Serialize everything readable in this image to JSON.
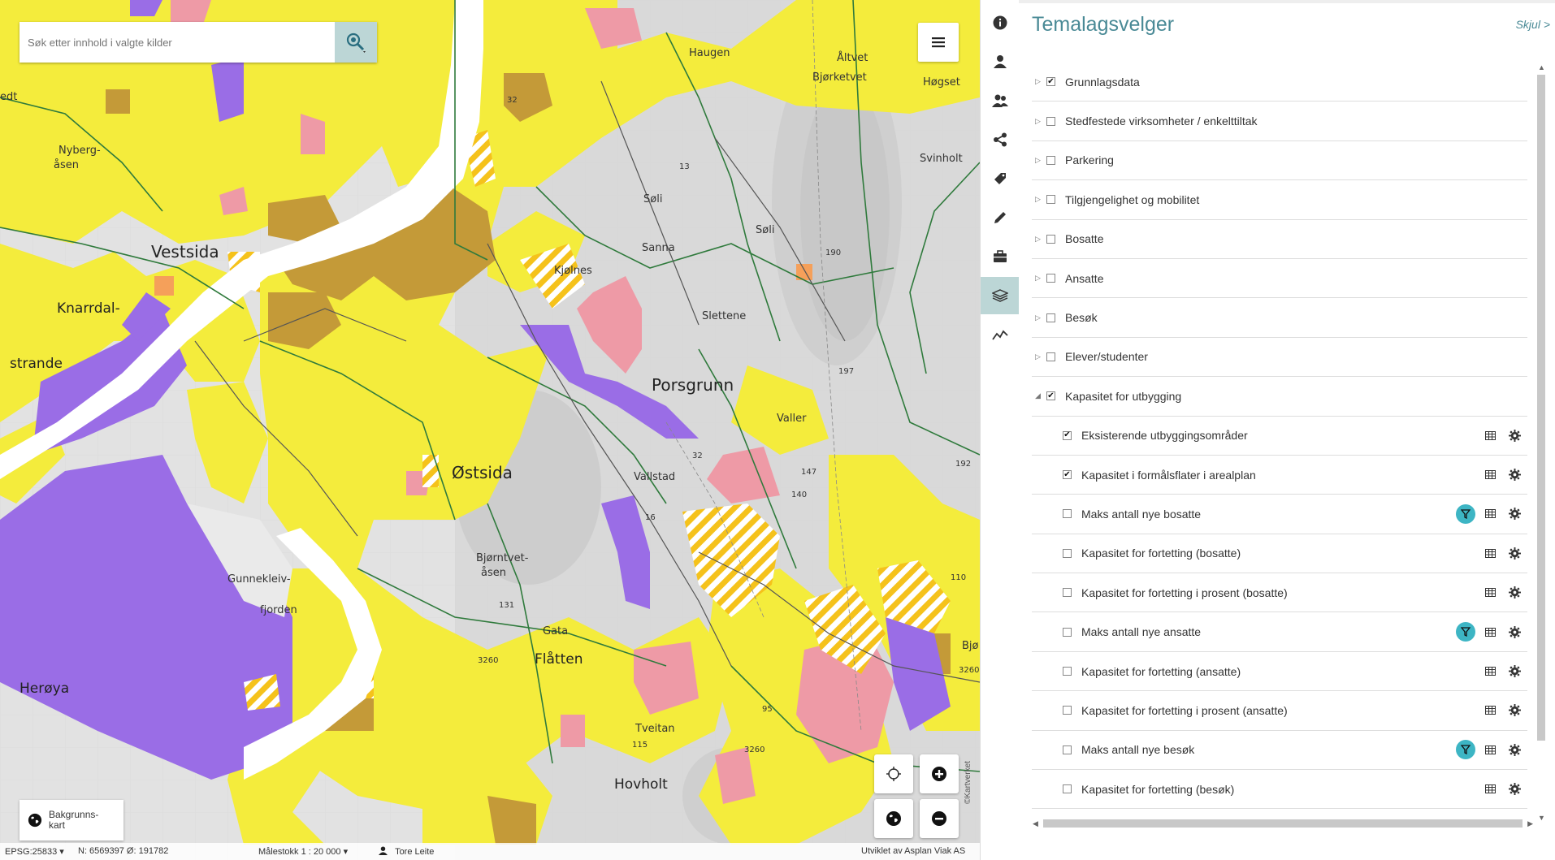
{
  "map": {
    "search_placeholder": "Søk etter innhold i valgte kilder",
    "labels": {
      "vestsida": "Vestsida",
      "knarrdal": "Knarrdal-",
      "strande": "strande",
      "heroya": "Herøya",
      "gunnekleiv": "Gunnekleiv-",
      "fjorden": "fjorden",
      "porsgrunn": "Porsgrunn",
      "ostsida": "Østsida",
      "bjorntvet": "Bjørntvet-",
      "asen": "åsen",
      "gata": "Gata",
      "flatten": "Flåtten",
      "tveitan": "Tveitan",
      "hovholt": "Hovholt",
      "vallstad": "Vallstad",
      "slettene": "Slettene",
      "sanna": "Sanna",
      "soli1": "Søli",
      "soli2": "Søli",
      "haugen": "Haugen",
      "altvet": "Åltvet",
      "bjorketvet": "Bjørketvet",
      "hogset": "Høgset",
      "svinholt": "Svinholt",
      "nyberg": "Nyberg-",
      "nyberg2": "åsen",
      "kjolnes": "Kjølnes",
      "valler": "Valler",
      "bjo": "Bjø",
      "n13": "13",
      "n32a": "32",
      "n32b": "32",
      "n16": "16",
      "n190": "190",
      "n197": "197",
      "n147": "147",
      "n140": "140",
      "n192": "192",
      "n110": "110",
      "n131": "131",
      "n115": "115",
      "n95": "95",
      "n3260a": "3260",
      "n3260b": "3260",
      "n3260c": "3260",
      "edt": "edt"
    },
    "background_button": "Bakgrunns-kart",
    "copyright": "©Kartverket",
    "status": {
      "epsg": "EPSG:25833",
      "coords": "N: 6569397 Ø: 191782",
      "scale": "Målestokk 1 : 20 000",
      "user": "Tore Leite",
      "credit": "Utviklet av Asplan Viak AS"
    },
    "colors": {
      "yellow": "#f4ec3c",
      "brown": "#c49a38",
      "purple": "#9a6de6",
      "pink": "#ee9aa6",
      "orange": "#f5a05a",
      "water": "#ffffff",
      "terrain": "#e3e3e3",
      "border_green": "#2f7a3c"
    }
  },
  "rail": {
    "icons": [
      "info-icon",
      "user-icon",
      "users-icon",
      "share-icon",
      "tag-icon",
      "pencil-icon",
      "briefcase-icon",
      "layers-icon",
      "chart-line-icon"
    ],
    "active": "layers-icon"
  },
  "panel": {
    "title": "Temalagsvelger",
    "hide": "Skjul >",
    "layers": [
      {
        "name": "Grunnlagsdata",
        "checked": true,
        "expandable": true,
        "sub": false
      },
      {
        "name": "Stedfestede virksomheter / enkelttiltak",
        "checked": false,
        "expandable": true,
        "sub": false
      },
      {
        "name": "Parkering",
        "checked": false,
        "expandable": true,
        "sub": false
      },
      {
        "name": "Tilgjengelighet og mobilitet",
        "checked": false,
        "expandable": true,
        "sub": false
      },
      {
        "name": "Bosatte",
        "checked": false,
        "expandable": true,
        "sub": false
      },
      {
        "name": "Ansatte",
        "checked": false,
        "expandable": true,
        "sub": false
      },
      {
        "name": "Besøk",
        "checked": false,
        "expandable": true,
        "sub": false
      },
      {
        "name": "Elever/studenter",
        "checked": false,
        "expandable": true,
        "sub": false
      },
      {
        "name": "Kapasitet for utbygging",
        "checked": true,
        "expandable": true,
        "expanded": true,
        "sub": false
      },
      {
        "name": "Eksisterende utbyggingsområder",
        "checked": true,
        "sub": true,
        "filter": false
      },
      {
        "name": "Kapasitet i formålsflater i arealplan",
        "checked": true,
        "sub": true,
        "filter": false
      },
      {
        "name": "Maks antall nye bosatte",
        "checked": false,
        "sub": true,
        "filter": true
      },
      {
        "name": "Kapasitet for fortetting (bosatte)",
        "checked": false,
        "sub": true,
        "filter": false
      },
      {
        "name": "Kapasitet for fortetting i prosent (bosatte)",
        "checked": false,
        "sub": true,
        "filter": false
      },
      {
        "name": "Maks antall nye ansatte",
        "checked": false,
        "sub": true,
        "filter": true
      },
      {
        "name": "Kapasitet for fortetting (ansatte)",
        "checked": false,
        "sub": true,
        "filter": false
      },
      {
        "name": "Kapasitet for fortetting i prosent (ansatte)",
        "checked": false,
        "sub": true,
        "filter": false
      },
      {
        "name": "Maks antall nye besøk",
        "checked": false,
        "sub": true,
        "filter": true
      },
      {
        "name": "Kapasitet for fortetting (besøk)",
        "checked": false,
        "sub": true,
        "filter": false
      }
    ]
  }
}
